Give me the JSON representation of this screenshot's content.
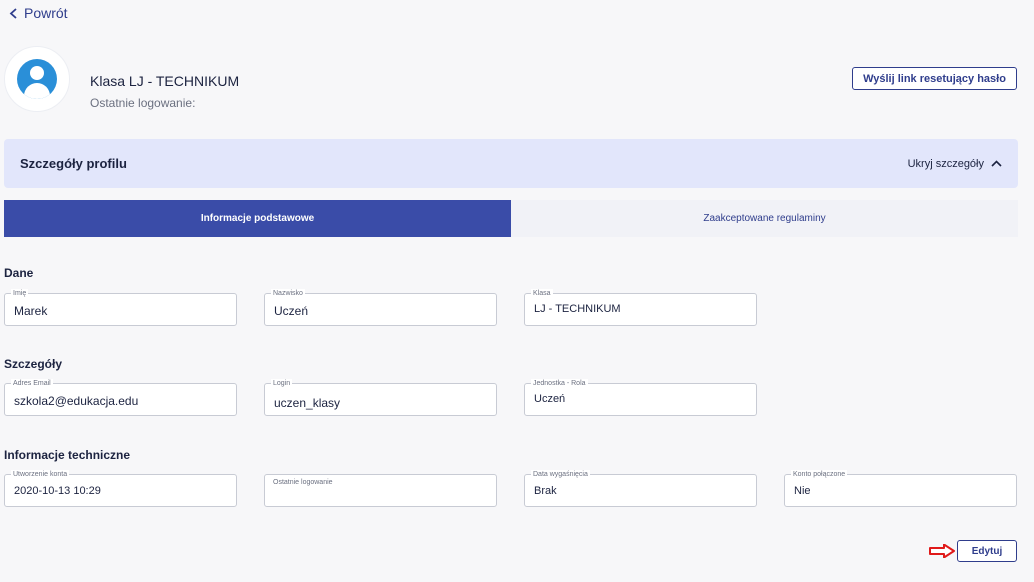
{
  "nav": {
    "back_label": "Powrót"
  },
  "profile": {
    "name": "Klasa LJ - TECHNIKUM",
    "last_login_label": "Ostatnie logowanie:",
    "reset_button": "Wyślij link resetujący hasło"
  },
  "details_bar": {
    "title": "Szczegóły profilu",
    "toggle_label": "Ukryj szczegóły"
  },
  "tabs": [
    {
      "label": "Informacje podstawowe"
    },
    {
      "label": "Zaakceptowane regulaminy"
    }
  ],
  "sections": {
    "dane": "Dane",
    "szczegoly": "Szczegóły",
    "techniczne": "Informacje techniczne"
  },
  "fields": {
    "imie": {
      "label": "Imię",
      "value": "Marek"
    },
    "nazwisko": {
      "label": "Nazwisko",
      "value": "Uczeń"
    },
    "klasa": {
      "label": "Klasa",
      "value": "LJ - TECHNIKUM"
    },
    "email": {
      "label": "Adres Email",
      "value": "szkola2@edukacja.edu"
    },
    "login": {
      "label": "Login",
      "value": "uczen_klasy"
    },
    "rola": {
      "label": "Jednostka - Rola",
      "value": "Uczeń"
    },
    "utworzenie": {
      "label": "Utworzenie konta",
      "value": "2020-10-13 10:29"
    },
    "ostatnie": {
      "label": "Ostatnie logowanie",
      "value": ""
    },
    "wygasniecie": {
      "label": "Data wygaśnięcia",
      "value": "Brak"
    },
    "polaczone": {
      "label": "Konto połączone",
      "value": "Nie"
    }
  },
  "actions": {
    "edit_label": "Edytuj"
  },
  "colors": {
    "primary": "#3a4ca8",
    "accent": "#2f3d8c",
    "bar_bg": "#e2e6fb",
    "avatar": "#2a8fd8",
    "arrow": "#e01a1a"
  }
}
